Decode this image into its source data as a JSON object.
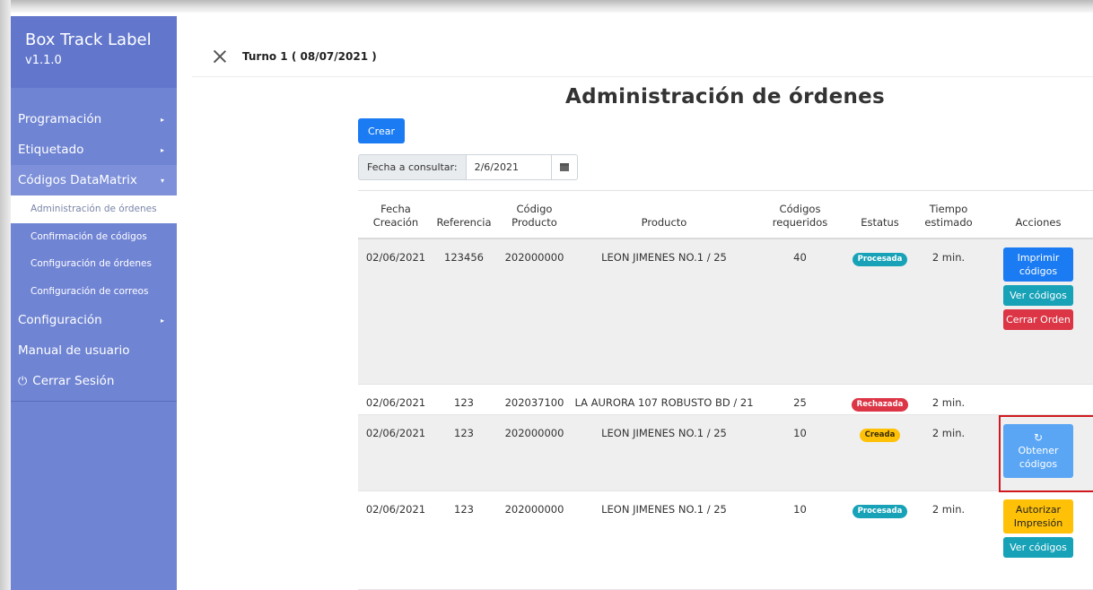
{
  "app": {
    "name": "Box Track Label",
    "version": "v1.1.0"
  },
  "sidebar": {
    "items": [
      {
        "label": "Programación",
        "caret": "▸"
      },
      {
        "label": "Etiquetado",
        "caret": "▸"
      },
      {
        "label": "Códigos DataMatrix",
        "caret": "▾"
      },
      {
        "label": "Configuración",
        "caret": "▸"
      },
      {
        "label": "Manual de usuario"
      },
      {
        "label": "Cerrar Sesión",
        "icon": "power-icon"
      }
    ],
    "subitems": [
      {
        "label": "Administración de órdenes",
        "active": true
      },
      {
        "label": "Confirmación de códigos"
      },
      {
        "label": "Configuración de órdenes"
      },
      {
        "label": "Configuración de correos"
      }
    ],
    "colors": {
      "background": "#6f84d3",
      "brand": "#6277cc",
      "active_bg": "#ffffff"
    }
  },
  "topbar": {
    "shift_label": "Turno 1 ( 08/07/2021 )"
  },
  "main": {
    "title": "Administración de órdenes",
    "create_button": "Crear",
    "date_filter": {
      "label": "Fecha a consultar:",
      "value": "2/6/2021",
      "icon": "calendar-icon"
    },
    "table": {
      "headers": [
        [
          "Fecha",
          "Creación"
        ],
        [
          "Referencia"
        ],
        [
          "Código",
          "Producto"
        ],
        [
          "Producto"
        ],
        [
          "Códigos",
          "requeridos"
        ],
        [
          "Estatus"
        ],
        [
          "Tiempo",
          "estimado"
        ],
        [
          "Acciones"
        ]
      ],
      "rows": [
        {
          "fecha": "02/06/2021",
          "referencia": "123456",
          "codigo": "202000000",
          "producto": "LEON JIMENES NO.1 / 25",
          "requeridos": "40",
          "estatus": "Procesada",
          "tiempo": "2 min.",
          "actions": [
            {
              "label": "Imprimir códigos",
              "color": "#1a7bf2"
            },
            {
              "label": "Ver códigos",
              "color": "#17a2b8"
            },
            {
              "label": "Cerrar Orden",
              "color": "#dc3545"
            }
          ]
        },
        {
          "fecha": "02/06/2021",
          "referencia": "123",
          "codigo": "202037100",
          "producto": "LA AURORA 107 ROBUSTO BD / 21",
          "requeridos": "25",
          "estatus": "Rechazada",
          "tiempo": "2 min.",
          "actions": []
        },
        {
          "fecha": "02/06/2021",
          "referencia": "123",
          "codigo": "202000000",
          "producto": "LEON JIMENES NO.1 / 25",
          "requeridos": "10",
          "estatus": "Creada",
          "tiempo": "2 min.",
          "actions": [
            {
              "label": "Obtener códigos",
              "color": "#5aa6f5",
              "spinner": "↻"
            }
          ]
        },
        {
          "fecha": "02/06/2021",
          "referencia": "123",
          "codigo": "202000000",
          "producto": "LEON JIMENES NO.1 / 25",
          "requeridos": "10",
          "estatus": "Procesada",
          "tiempo": "2 min.",
          "actions": [
            {
              "label": "Autorizar Impresión",
              "color": "#ffc107"
            },
            {
              "label": "Ver códigos",
              "color": "#17a2b8"
            }
          ]
        }
      ]
    }
  },
  "status_colors": {
    "Procesada": "#17a2b8",
    "Rechazada": "#dc3545",
    "Creada": "#ffc107"
  },
  "highlight_color": "#d0191f"
}
